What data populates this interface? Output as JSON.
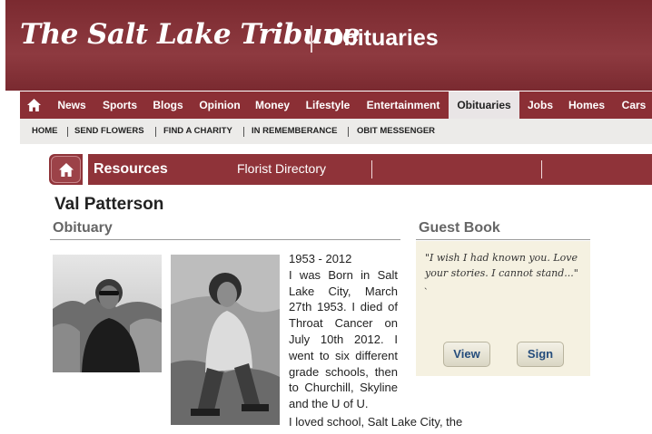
{
  "masthead": {
    "logo_text": "The Salt Lake Tribune",
    "section_title": "Obituaries"
  },
  "nav": {
    "home_icon": "home-icon",
    "items": [
      "News",
      "Sports",
      "Blogs",
      "Opinion",
      "Money",
      "Lifestyle",
      "Entertainment",
      "Obituaries",
      "Jobs",
      "Homes",
      "Cars"
    ],
    "active": "Obituaries"
  },
  "subnav": {
    "items": [
      "HOME",
      "SEND FLOWERS",
      "FIND A CHARITY",
      "IN REMEMBERANCE",
      "OBIT MESSENGER"
    ]
  },
  "resources": {
    "title": "Resources",
    "links": [
      "Florist Directory"
    ]
  },
  "person": {
    "name": "Val Patterson"
  },
  "obituary": {
    "heading": "Obituary",
    "years": "1953 - 2012",
    "text": "I was Born in Salt Lake City, March 27th 1953. I died of Throat Cancer on July 10th 2012. I went to six different grade schools, then to Churchill, Skyline and the U of U.",
    "text_wide": "I loved school, Salt Lake City, the"
  },
  "guestbook": {
    "heading": "Guest Book",
    "entry": "\"I wish I had known you. Love your stories. I cannot stand...\"",
    "tick": "`",
    "view_label": "View",
    "sign_label": "Sign"
  },
  "colors": {
    "brand": "#8b2f35",
    "guestbook_bg": "#f5f1e1",
    "button_text": "#254d7c"
  }
}
